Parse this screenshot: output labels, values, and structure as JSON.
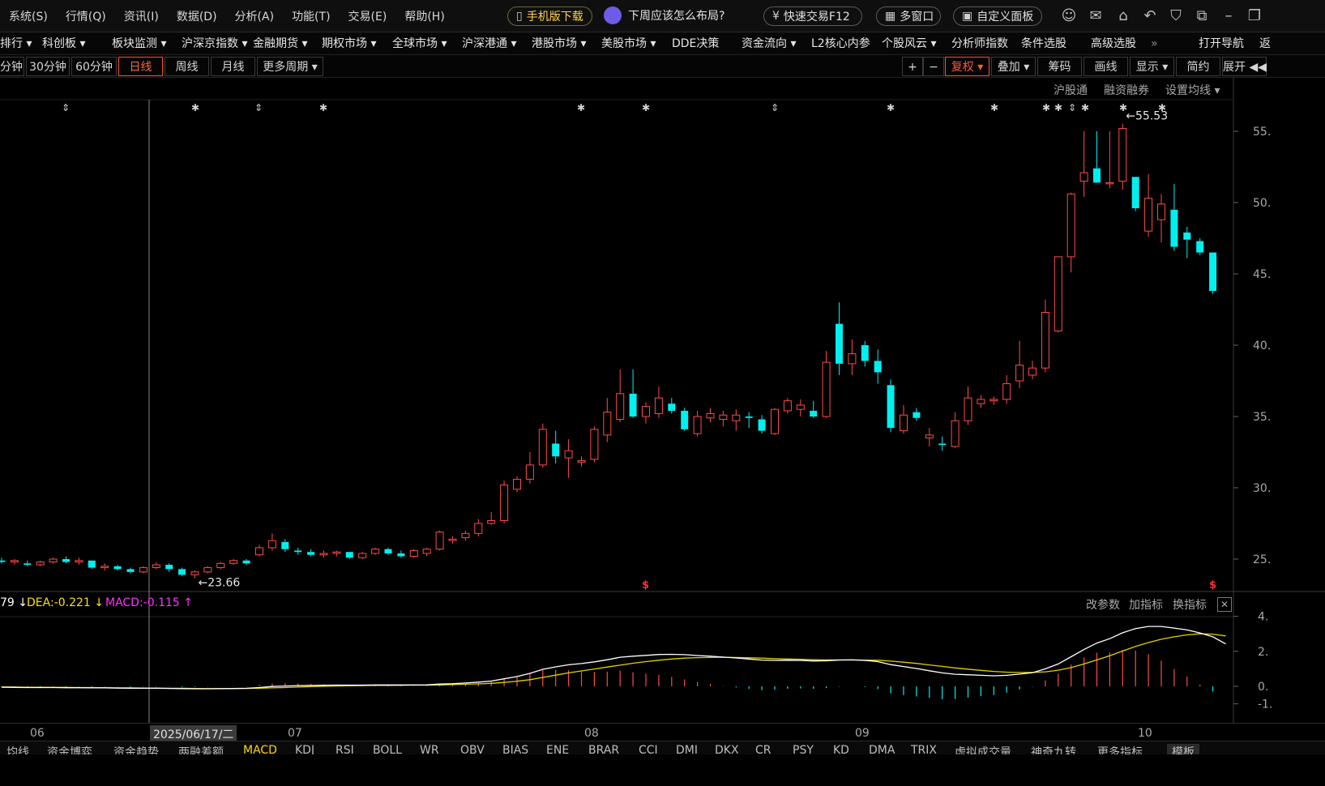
{
  "menubar": {
    "items": [
      "系统(S)",
      "行情(Q)",
      "资讯(I)",
      "数据(D)",
      "分析(A)",
      "功能(T)",
      "交易(E)",
      "帮助(H)"
    ],
    "mobile_download": "手机版下载",
    "promo": "下周应该怎么布局?",
    "quick_trade": "快速交易F12",
    "multi_window": "多窗口",
    "custom_panel": "自定义面板"
  },
  "navbar": {
    "items": [
      "排行 ▾",
      "科创板 ▾",
      "板块监测 ▾",
      "沪深京指数 ▾",
      "金融期货 ▾",
      "期权市场 ▾",
      "全球市场 ▾",
      "沪深港通 ▾",
      "港股市场 ▾",
      "美股市场 ▾",
      "DDE决策",
      "资金流向 ▾",
      "L2核心内参",
      "个股风云 ▾",
      "分析师指数",
      "条件选股",
      "高级选股",
      "»",
      "打开导航",
      "返"
    ]
  },
  "periodbar": {
    "periods": [
      "分钟",
      "30分钟",
      "60分钟",
      "日线",
      "周线",
      "月线",
      "更多周期 ▾"
    ],
    "active": "日线",
    "tools": [
      "+",
      "−",
      "复权 ▾",
      "叠加 ▾",
      "筹码",
      "画线",
      "显示 ▾",
      "简约",
      "展开 ◀◀"
    ]
  },
  "chart_links": [
    "沪股通",
    "融资融券",
    "设置均线 ▾"
  ],
  "price_axis": [
    "55.",
    "50.",
    "45.",
    "40.",
    "35.",
    "30.",
    "25."
  ],
  "annotations": {
    "high": "←55.53",
    "low": "←23.66"
  },
  "indicator": {
    "dif": "79 ↓",
    "dea": "DEA:-0.221 ↓",
    "macd": "MACD:-0.115 ↑",
    "links": [
      "改参数",
      "加指标",
      "换指标"
    ],
    "axis": [
      "4.",
      "2.",
      "0.",
      "-1."
    ]
  },
  "time_axis": {
    "labels": [
      "06",
      "07",
      "08",
      "09",
      "10"
    ],
    "cursor_date": "2025/06/17/二"
  },
  "bottom_tabs": [
    "均线",
    "资金博弈",
    "资金趋势",
    "两融差额",
    "MACD",
    "KDJ",
    "RSI",
    "BOLL",
    "WR",
    "OBV",
    "BIAS",
    "ENE",
    "BRAR",
    "CCI",
    "DMI",
    "DKX",
    "CR",
    "PSY",
    "KD",
    "DMA",
    "TRIX",
    "虚拟成交量",
    "神奇九转",
    "更多指标",
    "模板"
  ],
  "active_tab": "MACD",
  "colors": {
    "up": "#ff4a4a",
    "down": "#00f0f0",
    "dif_line": "#ffffff",
    "dea_line": "#e0d000",
    "macd_text": "#ff30ff",
    "dea_text": "#ffe000"
  },
  "chart_data": {
    "type": "candlestick",
    "ylim": [
      22,
      57
    ],
    "ohlc": [
      [
        24.9,
        25.1,
        24.7,
        24.8
      ],
      [
        24.8,
        25.0,
        24.6,
        24.9
      ],
      [
        24.7,
        24.9,
        24.5,
        24.6
      ],
      [
        24.6,
        24.9,
        24.5,
        24.8
      ],
      [
        24.8,
        25.1,
        24.7,
        25.0
      ],
      [
        25.0,
        25.2,
        24.7,
        24.8
      ],
      [
        24.8,
        25.1,
        24.6,
        24.9
      ],
      [
        24.9,
        24.9,
        24.3,
        24.4
      ],
      [
        24.4,
        24.7,
        24.2,
        24.5
      ],
      [
        24.5,
        24.6,
        24.2,
        24.3
      ],
      [
        24.3,
        24.4,
        24.0,
        24.1
      ],
      [
        24.1,
        24.5,
        24.0,
        24.4
      ],
      [
        24.4,
        24.8,
        24.3,
        24.6
      ],
      [
        24.6,
        24.7,
        24.1,
        24.3
      ],
      [
        24.3,
        24.4,
        23.8,
        23.9
      ],
      [
        23.9,
        24.2,
        23.66,
        24.1
      ],
      [
        24.1,
        24.5,
        24.0,
        24.4
      ],
      [
        24.4,
        24.8,
        24.3,
        24.7
      ],
      [
        24.7,
        25.0,
        24.6,
        24.9
      ],
      [
        24.9,
        25.0,
        24.6,
        24.7
      ],
      [
        25.3,
        26.0,
        25.2,
        25.8
      ],
      [
        25.8,
        26.8,
        25.6,
        26.3
      ],
      [
        26.2,
        26.4,
        25.5,
        25.7
      ],
      [
        25.6,
        25.8,
        25.3,
        25.5
      ],
      [
        25.5,
        25.7,
        25.2,
        25.3
      ],
      [
        25.3,
        25.6,
        25.1,
        25.4
      ],
      [
        25.4,
        25.6,
        25.2,
        25.5
      ],
      [
        25.5,
        25.5,
        25.0,
        25.1
      ],
      [
        25.1,
        25.5,
        25.0,
        25.4
      ],
      [
        25.4,
        25.8,
        25.3,
        25.7
      ],
      [
        25.7,
        25.8,
        25.3,
        25.4
      ],
      [
        25.4,
        25.6,
        25.1,
        25.2
      ],
      [
        25.2,
        25.7,
        25.1,
        25.6
      ],
      [
        25.4,
        25.8,
        25.2,
        25.7
      ],
      [
        25.7,
        27.0,
        25.6,
        26.9
      ],
      [
        26.3,
        26.6,
        26.1,
        26.4
      ],
      [
        26.5,
        27.0,
        26.3,
        26.8
      ],
      [
        26.8,
        27.8,
        26.6,
        27.5
      ],
      [
        27.5,
        28.3,
        27.4,
        27.7
      ],
      [
        27.7,
        30.5,
        27.5,
        30.2
      ],
      [
        29.9,
        30.8,
        29.7,
        30.6
      ],
      [
        30.6,
        32.5,
        30.3,
        31.6
      ],
      [
        31.6,
        34.5,
        31.4,
        34.1
      ],
      [
        33.1,
        34.0,
        31.7,
        32.2
      ],
      [
        32.1,
        33.4,
        30.7,
        32.6
      ],
      [
        31.8,
        32.2,
        31.5,
        31.9
      ],
      [
        32.0,
        34.3,
        31.8,
        34.1
      ],
      [
        33.7,
        36.3,
        33.2,
        35.3
      ],
      [
        34.8,
        38.3,
        34.6,
        36.6
      ],
      [
        36.6,
        38.3,
        34.9,
        35.0
      ],
      [
        35.0,
        36.0,
        34.5,
        35.7
      ],
      [
        35.2,
        37.1,
        34.9,
        36.3
      ],
      [
        35.9,
        36.3,
        35.2,
        35.4
      ],
      [
        35.4,
        35.6,
        34.0,
        34.1
      ],
      [
        33.8,
        35.4,
        33.6,
        35.0
      ],
      [
        34.9,
        35.6,
        34.6,
        35.2
      ],
      [
        34.8,
        35.4,
        34.3,
        35.1
      ],
      [
        34.7,
        35.5,
        34.0,
        35.1
      ],
      [
        35.0,
        35.3,
        34.2,
        34.9
      ],
      [
        34.8,
        35.1,
        33.8,
        34.0
      ],
      [
        33.8,
        35.6,
        33.7,
        35.5
      ],
      [
        35.4,
        36.3,
        35.2,
        36.1
      ],
      [
        35.5,
        36.2,
        35.0,
        35.8
      ],
      [
        35.4,
        36.1,
        34.9,
        35.0
      ],
      [
        35.0,
        39.6,
        34.9,
        38.8
      ],
      [
        41.5,
        43.0,
        37.9,
        38.7
      ],
      [
        38.7,
        40.4,
        37.9,
        39.4
      ],
      [
        40.0,
        40.3,
        38.5,
        38.9
      ],
      [
        38.9,
        39.7,
        37.3,
        38.1
      ],
      [
        37.2,
        37.6,
        33.9,
        34.2
      ],
      [
        34.0,
        35.8,
        33.8,
        35.1
      ],
      [
        35.3,
        35.6,
        34.7,
        34.9
      ],
      [
        33.5,
        34.2,
        32.9,
        33.7
      ],
      [
        33.1,
        33.6,
        32.6,
        33.0
      ],
      [
        32.9,
        35.3,
        32.8,
        34.7
      ],
      [
        34.7,
        37.1,
        34.4,
        36.3
      ],
      [
        35.9,
        36.5,
        35.6,
        36.2
      ],
      [
        36.1,
        36.4,
        35.8,
        36.2
      ],
      [
        36.2,
        37.9,
        35.9,
        37.3
      ],
      [
        37.5,
        40.3,
        37.0,
        38.6
      ],
      [
        37.9,
        38.9,
        37.6,
        38.4
      ],
      [
        38.4,
        43.2,
        38.1,
        42.3
      ],
      [
        41.0,
        42.3,
        40.9,
        46.2
      ],
      [
        46.2,
        50.7,
        45.1,
        50.6
      ],
      [
        51.5,
        55.0,
        50.4,
        52.1
      ],
      [
        52.4,
        55.0,
        51.8,
        51.4
      ],
      [
        51.4,
        55.0,
        51.0,
        51.4
      ],
      [
        51.5,
        55.53,
        50.9,
        55.2
      ],
      [
        51.8,
        51.8,
        49.4,
        49.6
      ],
      [
        48.0,
        52.0,
        47.6,
        50.3
      ],
      [
        48.8,
        50.6,
        47.2,
        49.9
      ],
      [
        49.5,
        51.3,
        46.6,
        46.9
      ],
      [
        47.9,
        48.3,
        46.1,
        47.4
      ],
      [
        47.3,
        47.5,
        46.3,
        46.5
      ],
      [
        46.5,
        46.5,
        43.6,
        43.8
      ]
    ],
    "macd": {
      "dif": [
        -0.05,
        -0.06,
        -0.07,
        -0.07,
        -0.07,
        -0.08,
        -0.08,
        -0.09,
        -0.09,
        -0.1,
        -0.11,
        -0.11,
        -0.11,
        -0.12,
        -0.13,
        -0.14,
        -0.14,
        -0.13,
        -0.12,
        -0.11,
        -0.07,
        -0.01,
        0.02,
        0.04,
        0.05,
        0.06,
        0.07,
        0.07,
        0.07,
        0.08,
        0.08,
        0.08,
        0.08,
        0.09,
        0.13,
        0.15,
        0.19,
        0.24,
        0.3,
        0.43,
        0.56,
        0.74,
        0.97,
        1.11,
        1.23,
        1.3,
        1.4,
        1.52,
        1.66,
        1.72,
        1.77,
        1.82,
        1.83,
        1.81,
        1.76,
        1.72,
        1.67,
        1.62,
        1.56,
        1.5,
        1.48,
        1.49,
        1.48,
        1.45,
        1.46,
        1.5,
        1.51,
        1.48,
        1.41,
        1.24,
        1.13,
        1.02,
        0.89,
        0.77,
        0.69,
        0.66,
        0.63,
        0.6,
        0.63,
        0.7,
        0.78,
        1.0,
        1.28,
        1.69,
        2.1,
        2.47,
        2.72,
        3.06,
        3.3,
        3.42,
        3.42,
        3.33,
        3.22,
        3.05,
        2.83,
        2.42
      ],
      "dea": [
        -0.03,
        -0.04,
        -0.05,
        -0.05,
        -0.06,
        -0.06,
        -0.07,
        -0.07,
        -0.08,
        -0.09,
        -0.09,
        -0.1,
        -0.1,
        -0.11,
        -0.11,
        -0.12,
        -0.13,
        -0.13,
        -0.13,
        -0.12,
        -0.11,
        -0.09,
        -0.07,
        -0.04,
        -0.02,
        0,
        0.02,
        0.03,
        0.04,
        0.05,
        0.05,
        0.06,
        0.07,
        0.07,
        0.08,
        0.1,
        0.12,
        0.14,
        0.17,
        0.22,
        0.29,
        0.38,
        0.51,
        0.64,
        0.77,
        0.88,
        0.99,
        1.1,
        1.21,
        1.32,
        1.41,
        1.49,
        1.56,
        1.61,
        1.64,
        1.65,
        1.66,
        1.65,
        1.63,
        1.61,
        1.58,
        1.56,
        1.54,
        1.52,
        1.51,
        1.51,
        1.51,
        1.5,
        1.49,
        1.44,
        1.38,
        1.31,
        1.22,
        1.14,
        1.05,
        0.98,
        0.91,
        0.85,
        0.81,
        0.79,
        0.79,
        0.83,
        0.92,
        1.07,
        1.28,
        1.51,
        1.75,
        2.02,
        2.28,
        2.5,
        2.69,
        2.83,
        2.94,
        3.0,
        2.98,
        2.88
      ]
    }
  }
}
